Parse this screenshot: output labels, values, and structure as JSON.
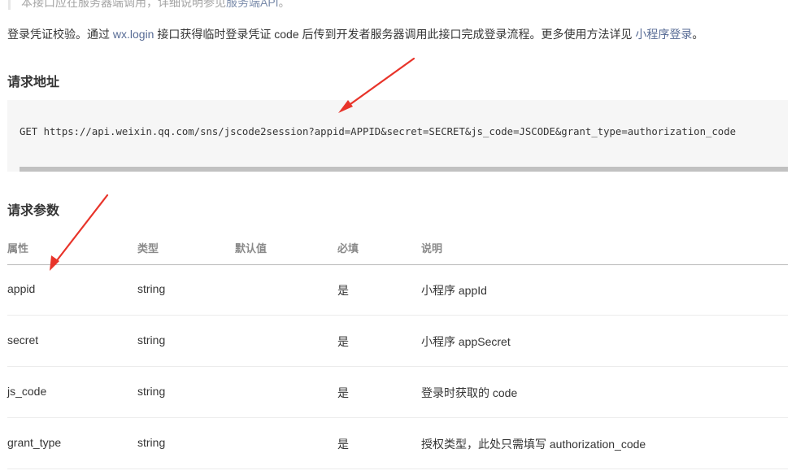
{
  "notice": {
    "text": "本接口应在服务器端调用，详细说明参见",
    "link": "服务端API",
    "tail": "。"
  },
  "intro": {
    "part1": "登录凭证校验。通过 ",
    "link1": "wx.login",
    "part2": " 接口获得临时登录凭证 code 后传到开发者服务器调用此接口完成登录流程。更多使用方法详见 ",
    "link2": "小程序登录",
    "part3": "。"
  },
  "request_url": {
    "heading": "请求地址",
    "code": "GET https://api.weixin.qq.com/sns/jscode2session?appid=APPID&secret=SECRET&js_code=JSCODE&grant_type=authorization_code"
  },
  "params": {
    "heading": "请求参数",
    "columns": [
      "属性",
      "类型",
      "默认值",
      "必填",
      "说明"
    ],
    "rows": [
      {
        "name": "appid",
        "type": "string",
        "default": "",
        "required": "是",
        "desc": "小程序 appId"
      },
      {
        "name": "secret",
        "type": "string",
        "default": "",
        "required": "是",
        "desc": "小程序 appSecret"
      },
      {
        "name": "js_code",
        "type": "string",
        "default": "",
        "required": "是",
        "desc": "登录时获取的 code"
      },
      {
        "name": "grant_type",
        "type": "string",
        "default": "",
        "required": "是",
        "desc": "授权类型，此处只需填写 authorization_code"
      }
    ]
  },
  "colors": {
    "link": "#576b95",
    "annotation": "#e8342a"
  }
}
